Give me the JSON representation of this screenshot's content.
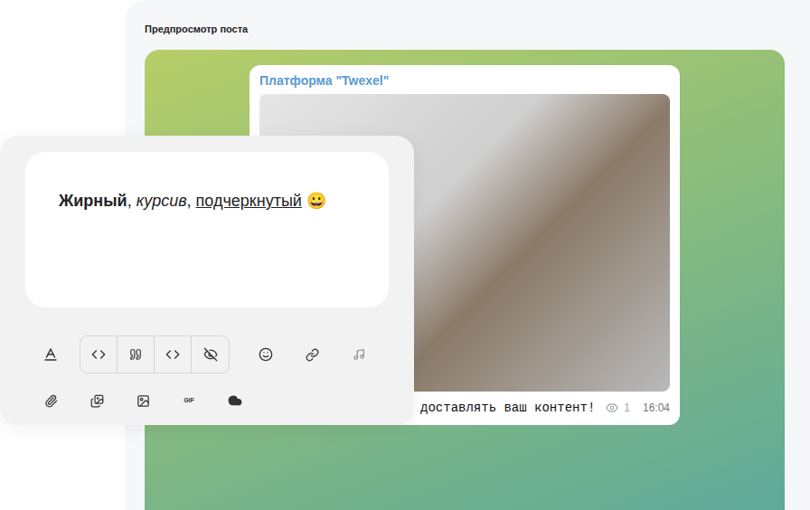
{
  "preview": {
    "title": "Предпросмотр поста"
  },
  "post": {
    "channel": "Платформа \"Twexel\"",
    "text": "доставлять ваш контент!",
    "views": "1",
    "time": "16:04"
  },
  "editor": {
    "segments": [
      {
        "text": "Жирный",
        "style": "bold"
      },
      {
        "text": ", ",
        "style": "plain"
      },
      {
        "text": "курсив",
        "style": "italic"
      },
      {
        "text": ", ",
        "style": "plain"
      },
      {
        "text": "подчеркнутый",
        "style": "underline"
      },
      {
        "text": " 😀",
        "style": "plain"
      }
    ],
    "toolbar": {
      "gif_label": "GIF"
    }
  }
}
